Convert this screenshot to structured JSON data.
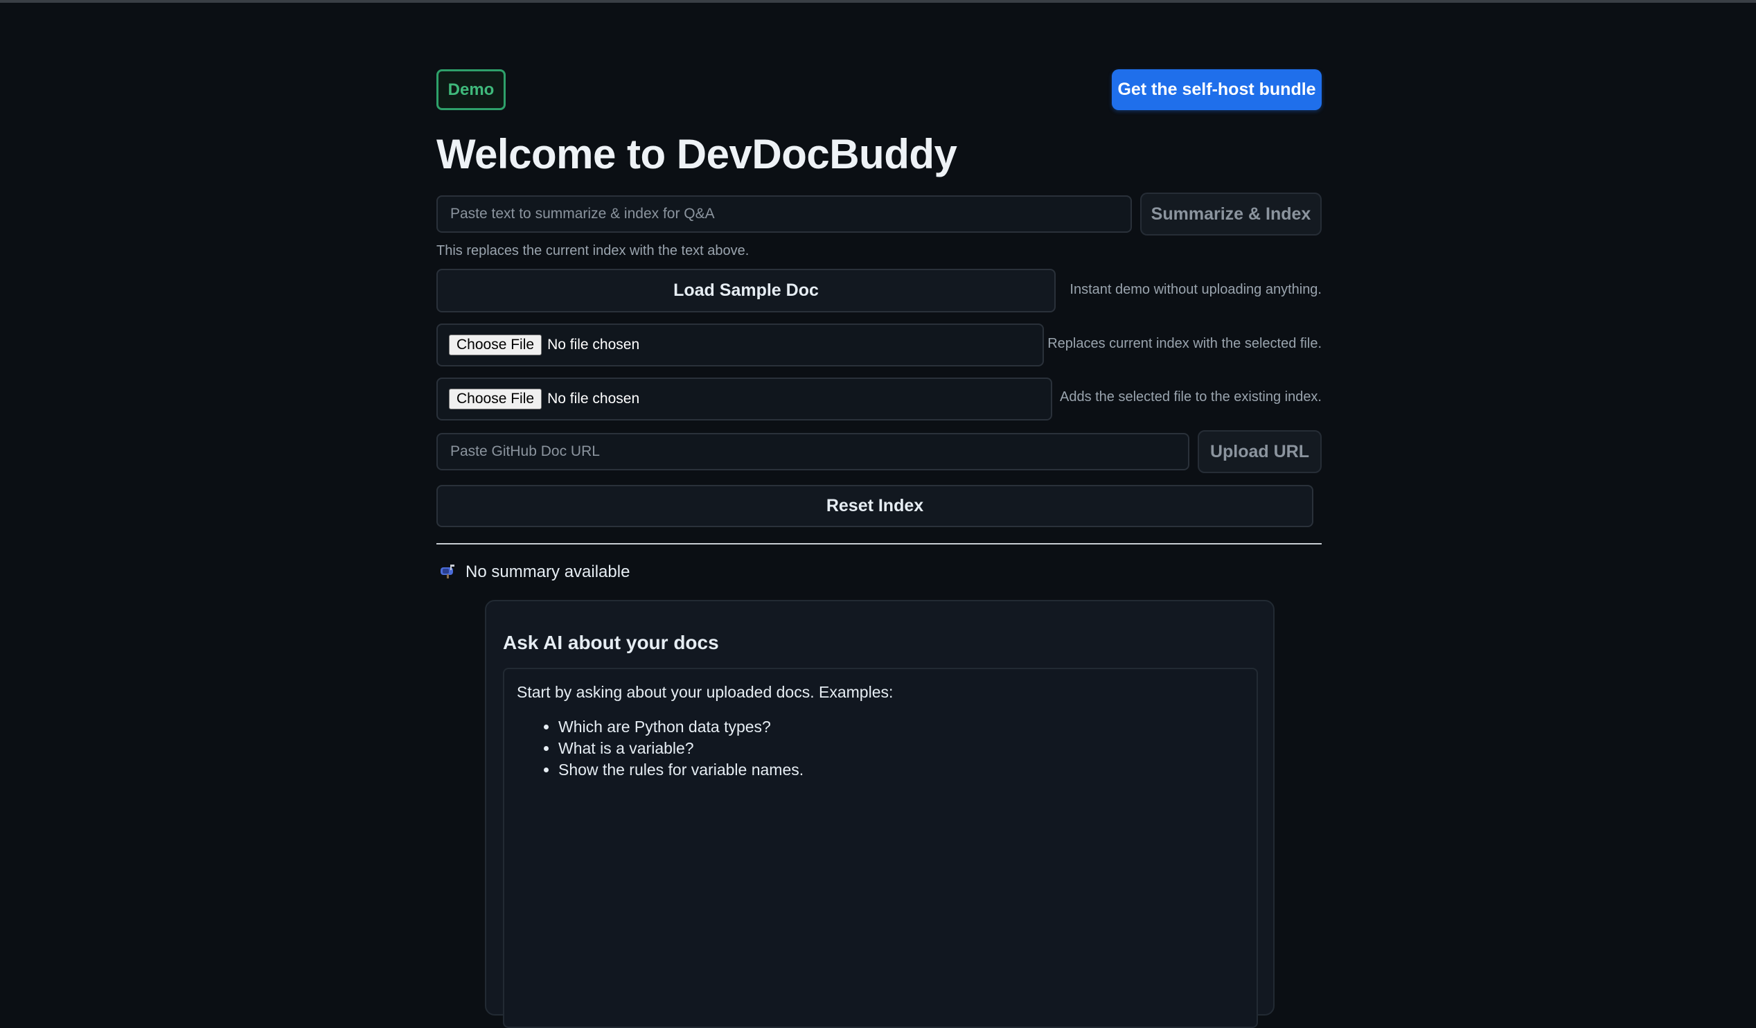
{
  "header": {
    "badge": "Demo",
    "bundle_button": "Get the self-host bundle",
    "title": "Welcome to DevDocBuddy"
  },
  "summarize": {
    "placeholder": "Paste text to summarize & index for Q&A",
    "button": "Summarize & Index",
    "hint": "This replaces the current index with the text above."
  },
  "sample": {
    "button": "Load Sample Doc",
    "hint": "Instant demo without uploading anything."
  },
  "upload_replace": {
    "choose_label": "Choose File",
    "status": "No file chosen",
    "hint": "Replaces current index with the selected file."
  },
  "upload_add": {
    "choose_label": "Choose File",
    "status": "No file chosen",
    "hint": "Adds the selected file to the existing index."
  },
  "url": {
    "placeholder": "Paste GitHub Doc URL",
    "button": "Upload URL"
  },
  "reset": {
    "button": "Reset Index"
  },
  "summary": {
    "icon": "mailbox-icon",
    "text": "No summary available"
  },
  "qa": {
    "title": "Ask AI about your docs",
    "intro": "Start by asking about your uploaded docs. Examples:",
    "examples": [
      "Which are Python data types?",
      "What is a variable?",
      "Show the rules for variable names."
    ]
  },
  "colors": {
    "background": "#0b0f14",
    "accent": "#1f6feb",
    "badge_green": "#2ea06a"
  }
}
